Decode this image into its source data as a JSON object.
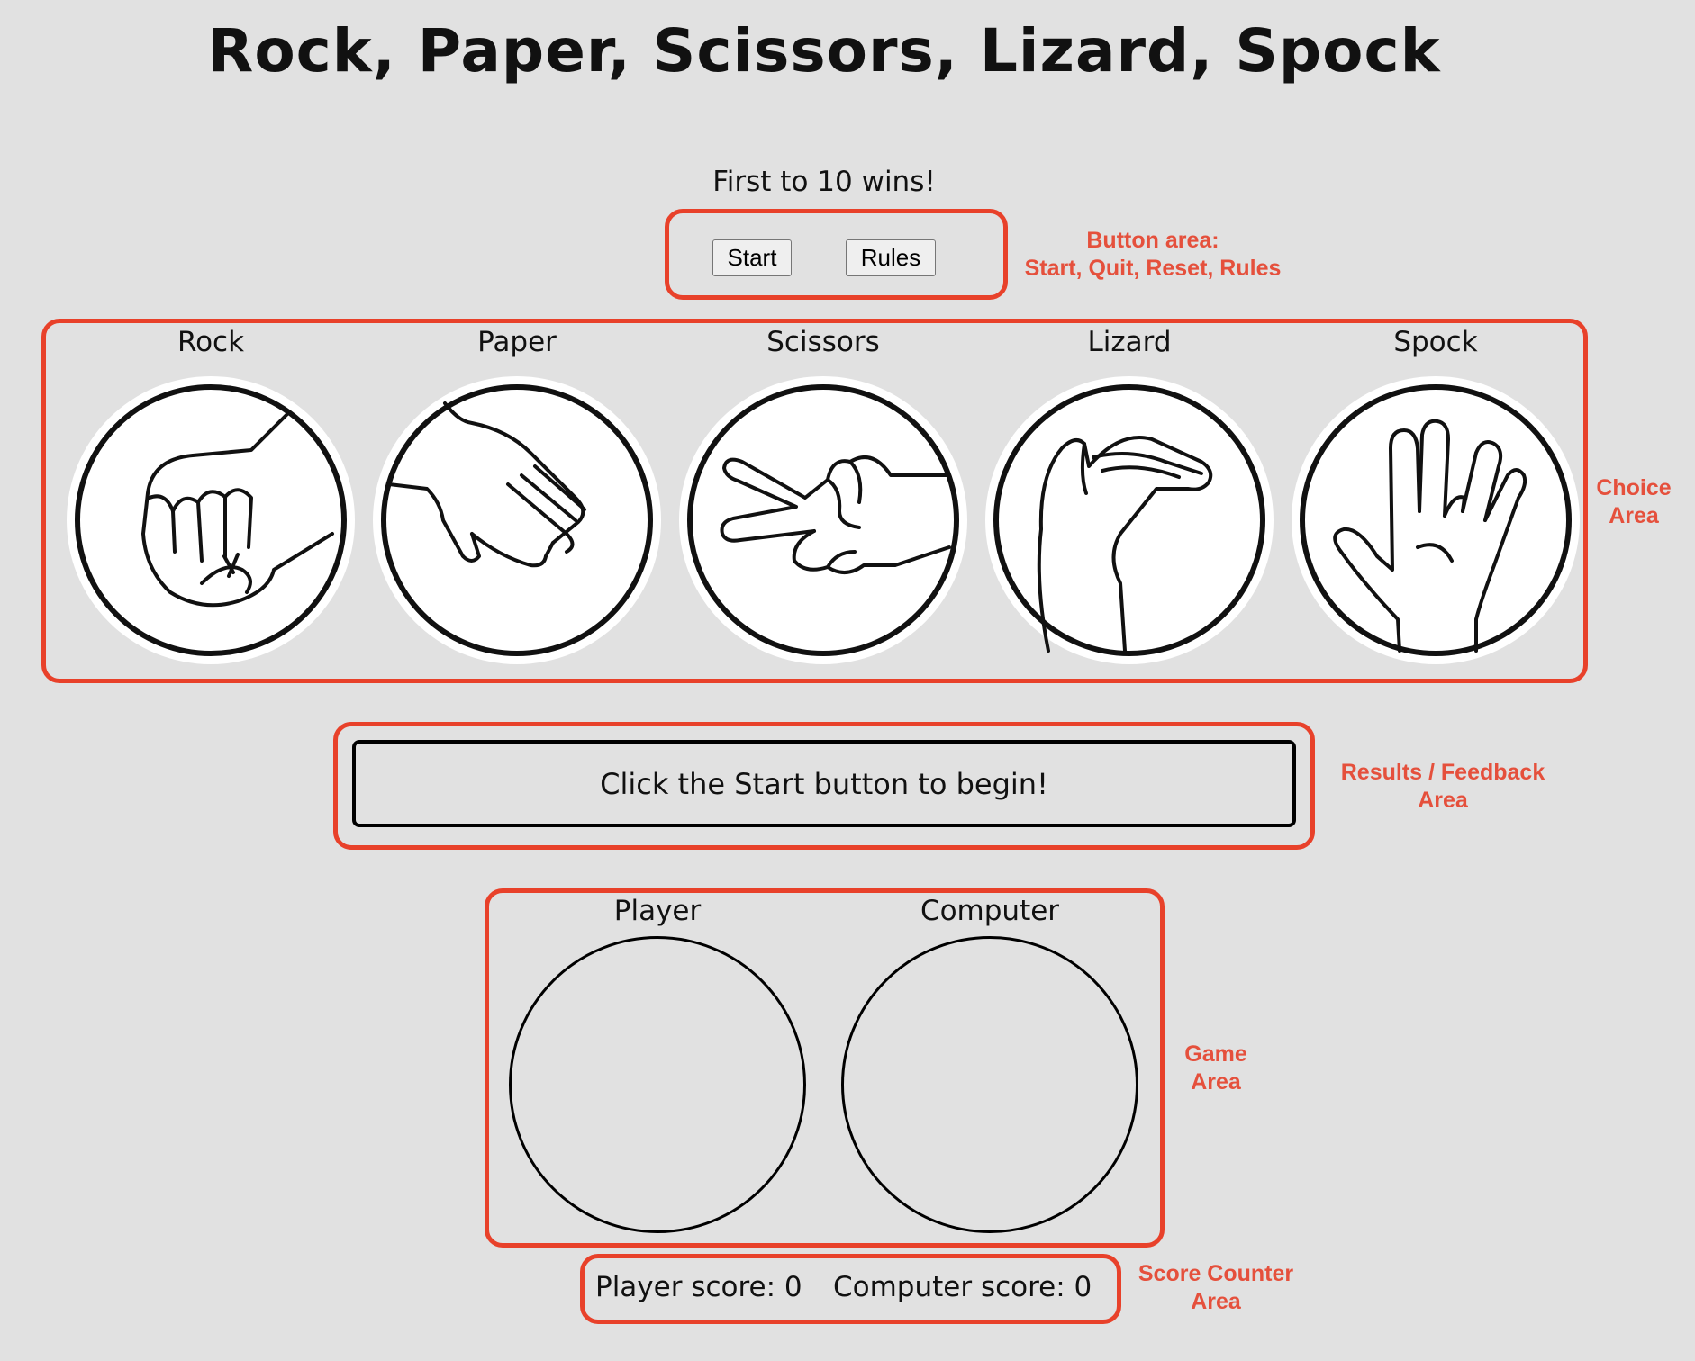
{
  "header": {
    "title": "Rock, Paper, Scissors, Lizard, Spock",
    "subtitle": "First to 10 wins!"
  },
  "buttons": {
    "start_label": "Start",
    "rules_label": "Rules"
  },
  "choices": [
    {
      "label": "Rock",
      "icon": "rock-fist-icon"
    },
    {
      "label": "Paper",
      "icon": "paper-hand-icon"
    },
    {
      "label": "Scissors",
      "icon": "scissors-hand-icon"
    },
    {
      "label": "Lizard",
      "icon": "lizard-hand-icon"
    },
    {
      "label": "Spock",
      "icon": "spock-hand-icon"
    }
  ],
  "feedback": {
    "message": "Click the Start button to begin!"
  },
  "game": {
    "player_label": "Player",
    "computer_label": "Computer"
  },
  "score": {
    "player_text": "Player score: 0",
    "computer_text": "Computer score: 0"
  },
  "annotations": {
    "button_area_line1": "Button area:",
    "button_area_line2": "Start, Quit, Reset, Rules",
    "choice_area_line1": "Choice",
    "choice_area_line2": "Area",
    "results_area_line1": "Results / Feedback",
    "results_area_line2": "Area",
    "game_area_line1": "Game",
    "game_area_line2": "Area",
    "score_area_line1": "Score Counter",
    "score_area_line2": "Area"
  },
  "colors": {
    "background": "#e1e1e1",
    "annotation_red": "#e8412a",
    "ink": "#111111"
  }
}
